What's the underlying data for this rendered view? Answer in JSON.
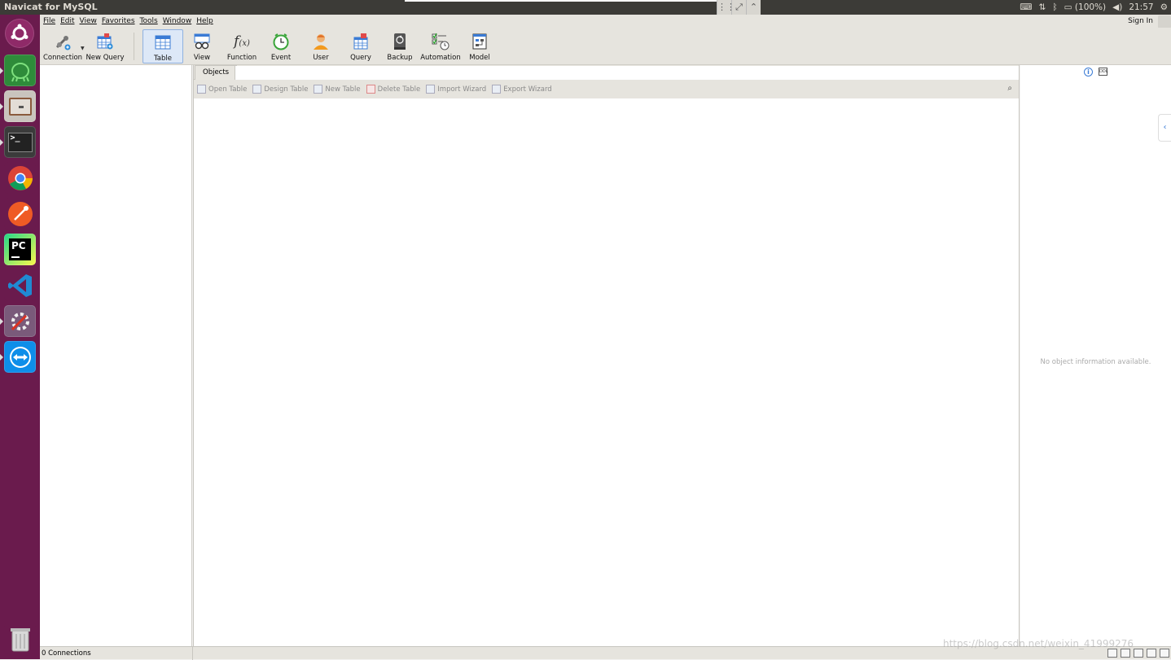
{
  "topbar": {
    "title": "Navicat for MySQL",
    "battery": "(100%)",
    "time": "21:57"
  },
  "launcher": {
    "items": [
      "ubuntu-dash",
      "gitkraken",
      "file-manager",
      "terminal",
      "chrome",
      "postman",
      "pycharm",
      "vscode",
      "system-tools",
      "teamviewer",
      "trash"
    ]
  },
  "menubar": {
    "items": [
      "File",
      "Edit",
      "View",
      "Favorites",
      "Tools",
      "Window",
      "Help"
    ],
    "signin": "Sign In"
  },
  "toolbar": {
    "buttons": [
      {
        "label": "Connection"
      },
      {
        "label": "New Query"
      },
      {
        "label": "Table"
      },
      {
        "label": "View"
      },
      {
        "label": "Function"
      },
      {
        "label": "Event"
      },
      {
        "label": "User"
      },
      {
        "label": "Query"
      },
      {
        "label": "Backup"
      },
      {
        "label": "Automation"
      },
      {
        "label": "Model"
      }
    ],
    "active": "Table"
  },
  "center": {
    "tab": "Objects",
    "actions": [
      "Open Table",
      "Design Table",
      "New Table",
      "Delete Table",
      "Import Wizard",
      "Export Wizard"
    ]
  },
  "rightpane": {
    "message": "No object information available."
  },
  "statusbar": {
    "connections": "0 Connections"
  },
  "watermark": "https://blog.csdn.net/weixin_41999276",
  "colors": {
    "launcher": "#6a1b4d",
    "topbar": "#3c3b37",
    "accent": "#3a7bd5"
  }
}
